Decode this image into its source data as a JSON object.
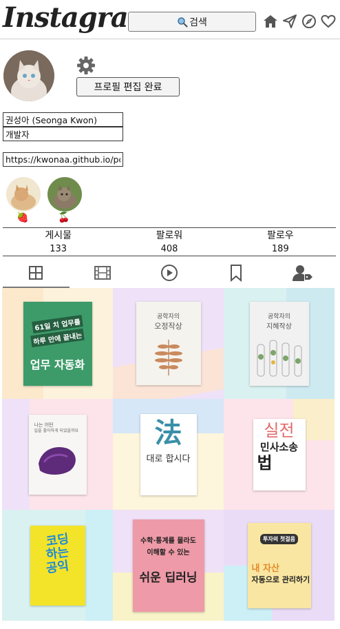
{
  "header": {
    "logo": "Instagram",
    "search_label": "검색",
    "icons": [
      "home-icon",
      "send-icon",
      "compass-icon",
      "heart-icon"
    ]
  },
  "profile": {
    "edit_done_label": "프로필 편집 완료",
    "name_value": "권성아 (Seonga Kwon)",
    "job_value": "개발자",
    "link_value": "https://kwonaa.github.io/portf",
    "highlights": [
      {
        "emoji": "🍓"
      },
      {
        "emoji": "🍒"
      }
    ]
  },
  "stats": [
    {
      "label": "게시물",
      "value": "133"
    },
    {
      "label": "팔로워",
      "value": "408"
    },
    {
      "label": "팔로우",
      "value": "189"
    }
  ],
  "tabs": [
    "grid-tab",
    "reels-tab",
    "video-tab",
    "saved-tab",
    "tagged-tab"
  ],
  "posts": [
    {
      "title_top": "61일 치 업무를",
      "title_mid": "하루 만에 끝내는",
      "title_main": "업무 자동화",
      "bg": "#fdf2dc"
    },
    {
      "title_top": "공학자의",
      "title_main": "오정작상",
      "bg": "#efe1f7"
    },
    {
      "title_top": "공학자의",
      "title_main": "지혜작상",
      "bg": "#d9f1f1"
    },
    {
      "title_top": "나는 어떤",
      "title_main": "일을 좋아하게 되었을까요",
      "bg": "#fde3ea"
    },
    {
      "title_top": "法",
      "title_main": "대로 합시다",
      "bg": "#fdf5dc"
    },
    {
      "title_top": "실전",
      "title_mid": "민사소송",
      "title_main": "법",
      "bg": "#fde3ea"
    },
    {
      "title_top": "코딩",
      "title_mid": "하는",
      "title_main": "공익",
      "bg": "#d9f1f1"
    },
    {
      "title_top": "수학·통계를 몰라도",
      "title_mid": "이해할 수 있는",
      "title_main": "쉬운 딥러닝",
      "bg": "#efe1f7"
    },
    {
      "title_top": "투자의 첫걸음",
      "title_mid": "내 자산",
      "title_main": "자동으로 관리하기",
      "bg": "#eadcf7"
    }
  ]
}
